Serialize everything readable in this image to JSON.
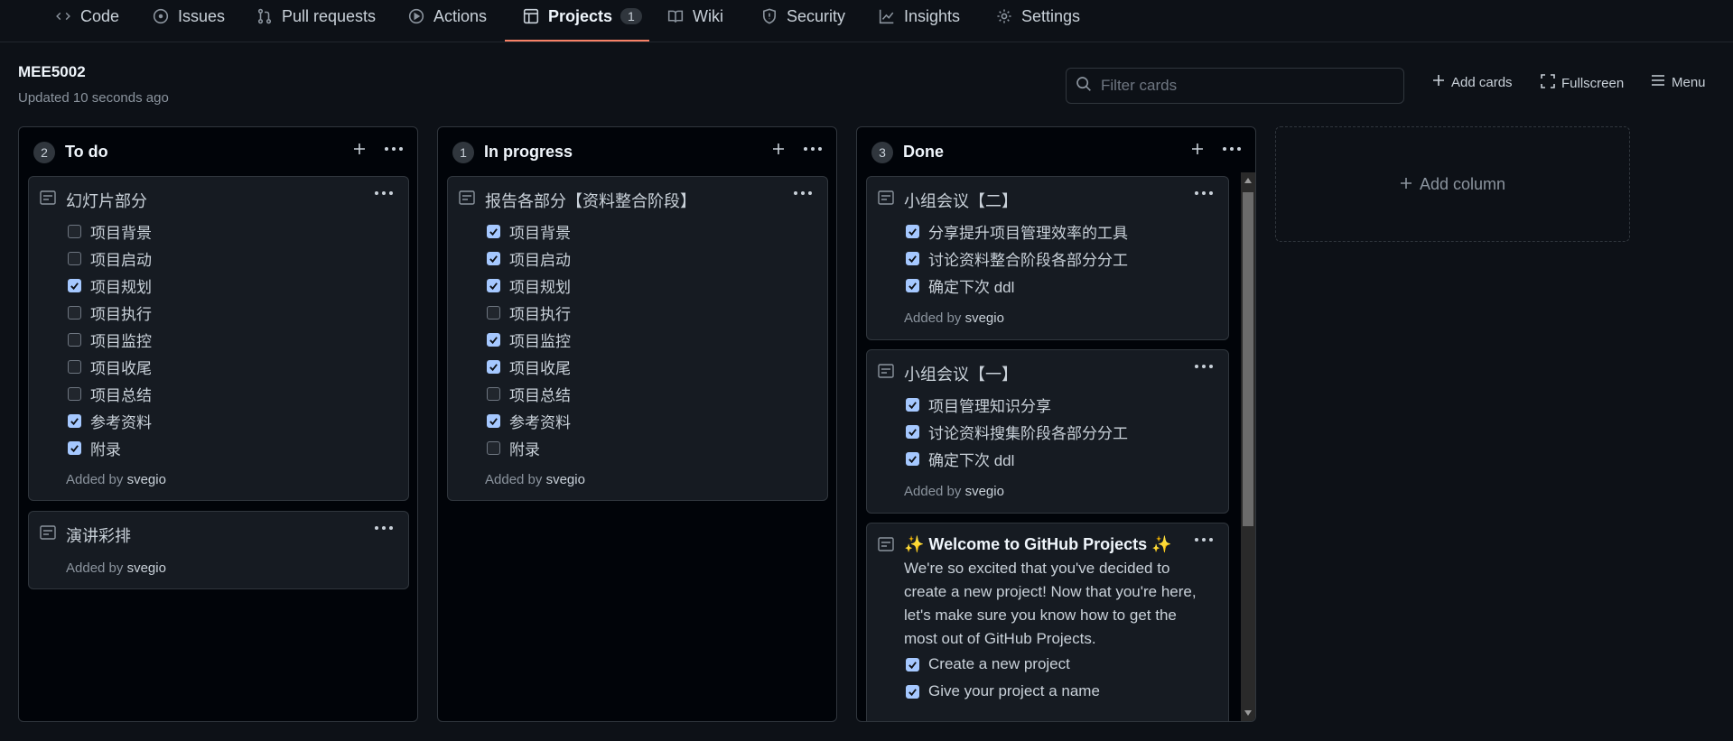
{
  "nav": {
    "tabs": [
      {
        "label": "Code",
        "icon": "code-icon"
      },
      {
        "label": "Issues",
        "icon": "issue-icon"
      },
      {
        "label": "Pull requests",
        "icon": "pull-request-icon"
      },
      {
        "label": "Actions",
        "icon": "play-icon"
      },
      {
        "label": "Projects",
        "icon": "table-icon",
        "count": "1",
        "active": true
      },
      {
        "label": "Wiki",
        "icon": "book-icon"
      },
      {
        "label": "Security",
        "icon": "shield-icon"
      },
      {
        "label": "Insights",
        "icon": "graph-icon"
      },
      {
        "label": "Settings",
        "icon": "gear-icon"
      }
    ]
  },
  "project": {
    "title": "MEE5002",
    "updated": "Updated 10 seconds ago"
  },
  "toolbar": {
    "filter_placeholder": "Filter cards",
    "add_cards": "Add cards",
    "fullscreen": "Fullscreen",
    "menu": "Menu"
  },
  "colors": {
    "accent": "#f78166",
    "checkbox": "#a5c8ff",
    "background": "#0d1117"
  },
  "columns": [
    {
      "count": "2",
      "name": "To do",
      "cards": [
        {
          "title": "幻灯片部分",
          "tasks": [
            {
              "label": "项目背景",
              "checked": false
            },
            {
              "label": "项目启动",
              "checked": false
            },
            {
              "label": "项目规划",
              "checked": true
            },
            {
              "label": "项目执行",
              "checked": false
            },
            {
              "label": "项目监控",
              "checked": false
            },
            {
              "label": "项目收尾",
              "checked": false
            },
            {
              "label": "项目总结",
              "checked": false
            },
            {
              "label": "参考资料",
              "checked": true
            },
            {
              "label": "附录",
              "checked": true
            }
          ],
          "added_prefix": "Added by",
          "added_by": "svegio"
        },
        {
          "title": "演讲彩排",
          "tasks": [],
          "added_prefix": "Added by",
          "added_by": "svegio"
        }
      ]
    },
    {
      "count": "1",
      "name": "In progress",
      "cards": [
        {
          "title": "报告各部分【资料整合阶段】",
          "tasks": [
            {
              "label": "项目背景",
              "checked": true
            },
            {
              "label": "项目启动",
              "checked": true
            },
            {
              "label": "项目规划",
              "checked": true
            },
            {
              "label": "项目执行",
              "checked": false
            },
            {
              "label": "项目监控",
              "checked": true
            },
            {
              "label": "项目收尾",
              "checked": true
            },
            {
              "label": "项目总结",
              "checked": false
            },
            {
              "label": "参考资料",
              "checked": true
            },
            {
              "label": "附录",
              "checked": false
            }
          ],
          "added_prefix": "Added by",
          "added_by": "svegio"
        }
      ]
    },
    {
      "count": "3",
      "name": "Done",
      "cards": [
        {
          "title": "小组会议【二】",
          "tasks": [
            {
              "label": "分享提升项目管理效率的工具",
              "checked": true
            },
            {
              "label": "讨论资料整合阶段各部分分工",
              "checked": true
            },
            {
              "label": "确定下次 ddl",
              "checked": true
            }
          ],
          "added_prefix": "Added by",
          "added_by": "svegio"
        },
        {
          "title": "小组会议【一】",
          "tasks": [
            {
              "label": "项目管理知识分享",
              "checked": true
            },
            {
              "label": "讨论资料搜集阶段各部分分工",
              "checked": true
            },
            {
              "label": "确定下次 ddl",
              "checked": true
            }
          ],
          "added_prefix": "Added by",
          "added_by": "svegio"
        },
        {
          "title": "✨ Welcome to GitHub Projects ✨",
          "text": "We're so excited that you've decided to create a new project! Now that you're here, let's make sure you know how to get the most out of GitHub Projects.",
          "tasks": [
            {
              "label": "Create a new project",
              "checked": true
            },
            {
              "label": "Give your project a name",
              "checked": true
            }
          ]
        }
      ]
    }
  ],
  "add_column": "Add column"
}
